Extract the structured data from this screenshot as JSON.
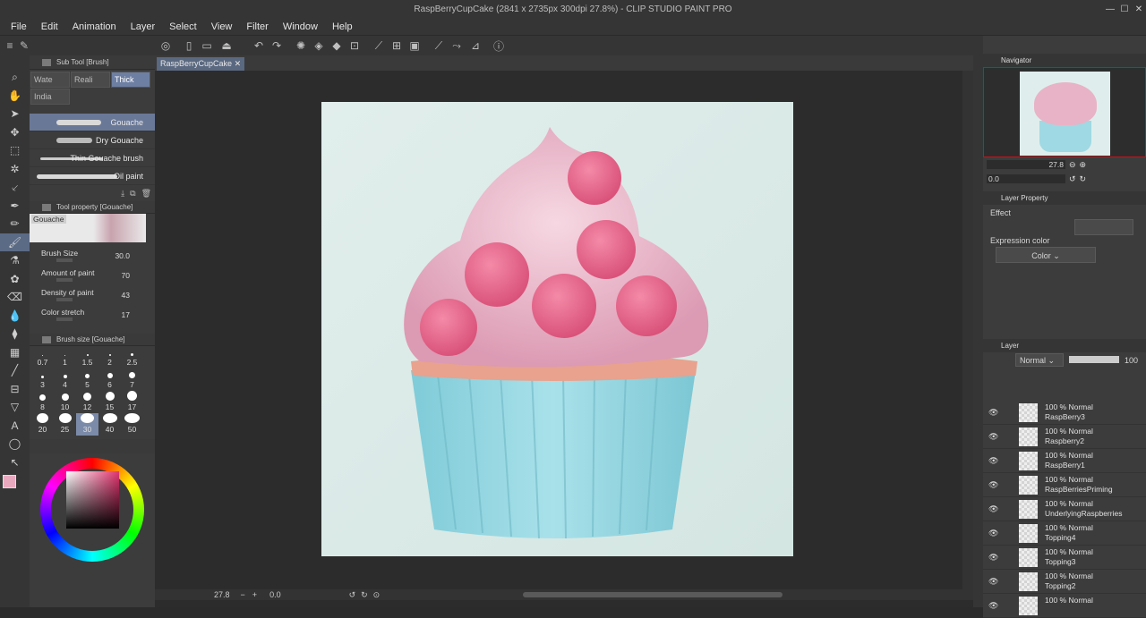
{
  "window": {
    "title": "RaspBerryCupCake (2841 x 2735px 300dpi 27.8%)  - CLIP STUDIO PAINT PRO"
  },
  "menu": [
    "File",
    "Edit",
    "Animation",
    "Layer",
    "Select",
    "View",
    "Filter",
    "Window",
    "Help"
  ],
  "document_tab": "RaspBerryCupCake",
  "sub_tool": {
    "title": "Sub Tool [Brush]",
    "tabs": [
      "Wate",
      "Reali",
      "Thick",
      "India"
    ],
    "brushes": [
      "Gouache",
      "Dry Gouache",
      "Thin Gouache brush",
      "Oil paint"
    ]
  },
  "tool_property": {
    "title": "Tool property [Gouache]",
    "preview_label": "Gouache",
    "props": [
      {
        "name": "Brush Size",
        "value": "30.0"
      },
      {
        "name": "Amount of paint",
        "value": "70"
      },
      {
        "name": "Density of paint",
        "value": "43"
      },
      {
        "name": "Color stretch",
        "value": "17"
      }
    ]
  },
  "brush_size_panel": {
    "title": "Brush size [Gouache]",
    "sizes": [
      "0.7",
      "1",
      "1.5",
      "2",
      "2.5",
      "3",
      "4",
      "5",
      "6",
      "7",
      "8",
      "10",
      "12",
      "15",
      "17",
      "20",
      "25",
      "30",
      "40",
      "50"
    ],
    "selected": "30"
  },
  "color": {
    "main": "#e8a9bf",
    "sub": "#c0b6d8",
    "readout": [
      "340",
      "31",
      "89"
    ]
  },
  "canvas_status": {
    "zoom": "27.8",
    "rotation": "0.0"
  },
  "navigator": {
    "title": "Navigator",
    "zoom": "27.8",
    "rotation": "0.0"
  },
  "layer_property": {
    "title": "Layer Property",
    "effect_label": "Effect",
    "expression_color_label": "Expression color",
    "expression_color_value": "Color"
  },
  "layer_panel": {
    "title": "Layer",
    "blend_mode": "Normal",
    "opacity": "100",
    "layers": [
      {
        "info": "100 % Normal",
        "name": "RaspBerry3"
      },
      {
        "info": "100 % Normal",
        "name": "Raspberry2"
      },
      {
        "info": "100 % Normal",
        "name": "RaspBerry1"
      },
      {
        "info": "100 % Normal",
        "name": "RaspBerriesPriming"
      },
      {
        "info": "100 % Normal",
        "name": "UnderlyingRaspberries"
      },
      {
        "info": "100 % Normal",
        "name": "Topping4"
      },
      {
        "info": "100 % Normal",
        "name": "Topping3"
      },
      {
        "info": "100 % Normal",
        "name": "Topping2"
      },
      {
        "info": "100 % Normal",
        "name": ""
      }
    ]
  },
  "icons": [
    "pen-icon",
    "eyedropper-icon",
    "zoom-icon",
    "hand-icon",
    "move-icon",
    "selection-icon",
    "wand-icon",
    "brush-icon",
    "eraser-icon",
    "fill-icon",
    "gradient-icon",
    "text-icon",
    "eye-icon"
  ]
}
